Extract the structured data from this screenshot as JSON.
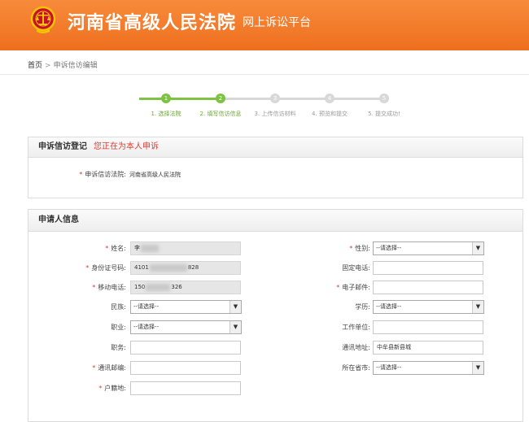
{
  "header": {
    "court_name": "河南省高级人民法院",
    "platform": "网上诉讼平台",
    "emblem": "court-emblem",
    "colors": {
      "bar": "#f07c2a",
      "text": "#ffffff"
    }
  },
  "breadcrumb": {
    "home": "首页",
    "separator": ">",
    "current": "申诉信访编辑"
  },
  "steps": [
    {
      "label": "1. 选择法院",
      "num": "1",
      "state": "done"
    },
    {
      "label": "2. 填写信访信息",
      "num": "2",
      "state": "active"
    },
    {
      "label": "3. 上传信访材料",
      "num": "3",
      "state": "todo"
    },
    {
      "label": "4. 预览和提交",
      "num": "4",
      "state": "todo"
    },
    {
      "label": "5. 提交成功!",
      "num": "5",
      "state": "todo"
    }
  ],
  "colors": {
    "step_done": "#7dc242",
    "step_todo": "#d8d8d8",
    "required": "#e23b2f"
  },
  "petition_panel": {
    "title": "申诉信访登记",
    "note": "您正在为本人申诉",
    "court_label": "申诉信访法院:",
    "court_value": "河南省高级人民法院"
  },
  "applicant_panel": {
    "title": "申请人信息",
    "name_label": "姓名:",
    "name_value": "李",
    "gender_label": "性别:",
    "gender_value": "--请选择--",
    "id_label": "身份证号码:",
    "id_prefix": "4101",
    "id_suffix": "828",
    "phone_label": "固定电话:",
    "mobile_label": "移动电话:",
    "mobile_prefix": "150",
    "mobile_suffix": "326",
    "email_label": "电子邮件:",
    "ethnic_label": "民族:",
    "ethnic_value": "--请选择--",
    "education_label": "学历:",
    "education_value": "--请选择--",
    "occupation_label": "职业:",
    "occupation_value": "--请选择--",
    "employer_label": "工作单位:",
    "position_label": "职务:",
    "address_label": "通讯地址:",
    "address_value": "中牟县新县城",
    "postcode_label": "通讯邮编:",
    "city_label": "所在省市:",
    "city_value": "--请选择--",
    "household_label": "户籍地:"
  }
}
